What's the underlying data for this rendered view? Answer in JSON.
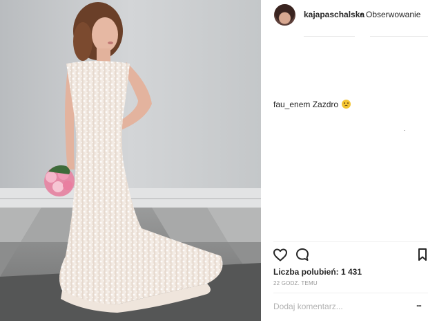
{
  "post": {
    "photo": {
      "description_icon": "photo-image"
    },
    "header": {
      "username": "kajapaschalska",
      "separator": "•",
      "follow_label": "Obserwowanie"
    },
    "comments": [
      {
        "username": "fau_enem",
        "text": "Zazdro",
        "emoji_icon": "confounded-face-icon"
      }
    ],
    "actions": {
      "like_icon": "heart-icon",
      "comment_icon": "comment-bubble-icon",
      "save_icon": "bookmark-icon"
    },
    "likes_text": "Liczba polubień: 1 431",
    "timestamp": "22 GODZ. TEMU",
    "add_comment": {
      "placeholder": "Dodaj komentarz...",
      "value": ""
    },
    "more_label": "...",
    "colors": {
      "text": "#262626",
      "muted": "#999999",
      "divider": "#efefef",
      "emoji": "#f4c533"
    }
  }
}
